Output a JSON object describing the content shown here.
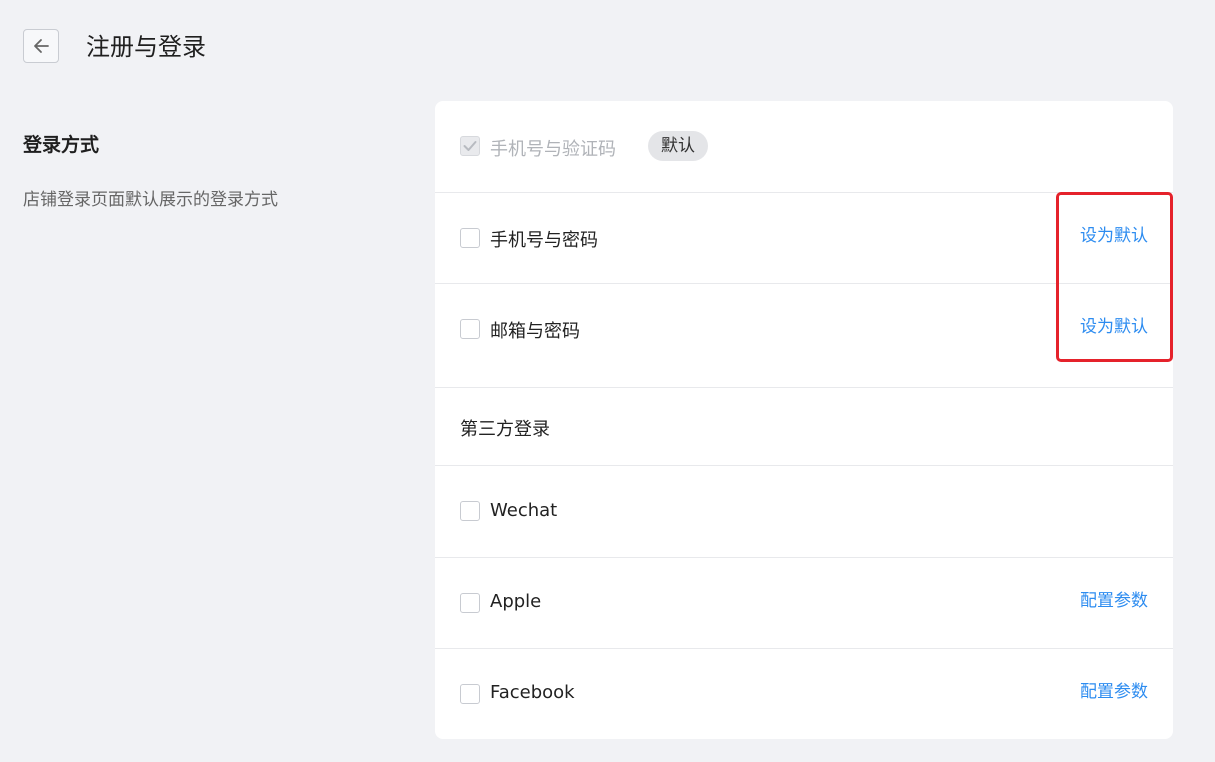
{
  "header": {
    "title": "注册与登录",
    "back_icon": "arrow-left-icon"
  },
  "section": {
    "title": "登录方式",
    "description": "店铺登录页面默认展示的登录方式"
  },
  "login_methods": [
    {
      "label": "手机号与验证码",
      "checked": true,
      "disabled": true,
      "badge": "默认"
    },
    {
      "label": "手机号与密码",
      "checked": false,
      "action": "设为默认"
    },
    {
      "label": "邮箱与密码",
      "checked": false,
      "action": "设为默认"
    }
  ],
  "third_party": {
    "title": "第三方登录",
    "items": [
      {
        "label": "Wechat",
        "checked": false
      },
      {
        "label": "Apple",
        "checked": false,
        "action": "配置参数"
      },
      {
        "label": "Facebook",
        "checked": false,
        "action": "配置参数"
      }
    ]
  },
  "colors": {
    "link": "#2d8cf0",
    "highlight": "#e5222b",
    "background": "#f1f2f5"
  }
}
